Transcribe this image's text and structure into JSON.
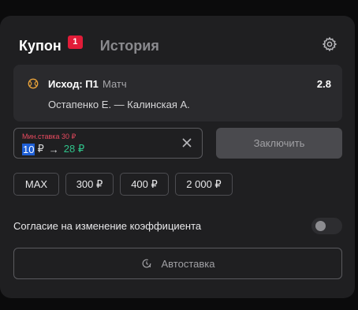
{
  "tabs": {
    "active": "Купон",
    "badge": "1",
    "inactive": "История"
  },
  "bet": {
    "outcome_label": "Исход: П1",
    "market": "Матч",
    "odds": "2.8",
    "match": "Остапенко Е. — Калинская А.",
    "sport_icon": "tennis-ball-icon"
  },
  "stake": {
    "min_label": "Мин.ставка 30 ₽",
    "old_value": "10",
    "old_currency": "₽",
    "arrow": "→",
    "new_value": "28 ₽"
  },
  "submit_label": "Заключить",
  "quick_amounts": [
    "MAX",
    "300 ₽",
    "400 ₽",
    "2 000 ₽"
  ],
  "consent_label": "Согласие на изменение коэффициента",
  "consent_enabled": false,
  "autobet_label": "Автоставка",
  "colors": {
    "accent_red": "#e11c38",
    "new_value_green": "#2fc38a",
    "selection_blue": "#1e5fd6",
    "ball_orange": "#e8a23a"
  }
}
